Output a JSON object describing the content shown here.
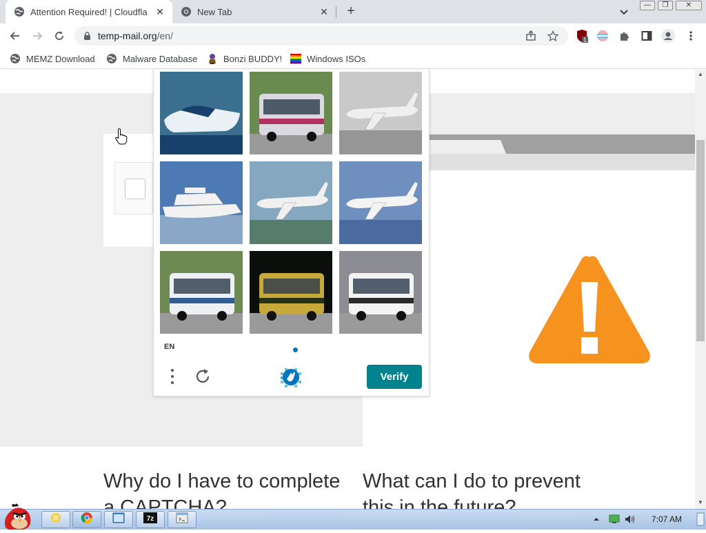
{
  "browser": {
    "tabs": [
      {
        "title": "Attention Required! | Cloudfla",
        "active": true
      },
      {
        "title": "New Tab",
        "active": false
      }
    ],
    "address": {
      "domain": "temp-mail.org",
      "path": "/en/"
    },
    "bookmarks": [
      {
        "label": "MEMZ Download",
        "icon": "globe-icon"
      },
      {
        "label": "Malware Database",
        "icon": "globe-icon"
      },
      {
        "label": "Bonzi BUDDY!",
        "icon": "bonzi-icon"
      },
      {
        "label": "Windows ISOs",
        "icon": "rainbow-flag-icon"
      }
    ],
    "extension_badge": "1"
  },
  "captcha": {
    "images": [
      {
        "subject": "speedboat",
        "palette": [
          "#3a6f8f",
          "#e9f1f7",
          "#17406a"
        ]
      },
      {
        "subject": "bus",
        "palette": [
          "#6a8b4f",
          "#d9d9df",
          "#b2305d"
        ]
      },
      {
        "subject": "airplane",
        "palette": [
          "#c9c9c9",
          "#efefef",
          "#6c6c6c"
        ]
      },
      {
        "subject": "yacht",
        "palette": [
          "#4d79b5",
          "#f2f2f2",
          "#8aa7c8"
        ]
      },
      {
        "subject": "airplane",
        "palette": [
          "#86a7c0",
          "#f0f0f0",
          "#2f5a24"
        ]
      },
      {
        "subject": "airplane",
        "palette": [
          "#6f8fbf",
          "#f4f4f4",
          "#2d4d86"
        ]
      },
      {
        "subject": "bus",
        "palette": [
          "#6d8a52",
          "#eef1f3",
          "#2f5c93"
        ]
      },
      {
        "subject": "bus",
        "palette": [
          "#0c0e0c",
          "#c6a93a",
          "#263216"
        ]
      },
      {
        "subject": "bus",
        "palette": [
          "#8c8c95",
          "#f4f4f4",
          "#2a2a2a"
        ]
      }
    ],
    "language": "EN",
    "verify_label": "Verify",
    "colors": {
      "verify": "#00838f",
      "dot": "#0074bf"
    }
  },
  "page": {
    "left_heading": "Why do I have to complete a CAPTCHA?",
    "right_heading": "What can I do to prevent this in the future?",
    "colors": {
      "warning": "#f6921e"
    }
  },
  "taskbar": {
    "clock": "7:07 AM",
    "items": [
      "explorer-icon",
      "chrome-icon",
      "window-icon",
      "7zip-icon",
      "terminal-icon"
    ],
    "tray_icons": [
      "show-hidden-arrow-icon",
      "network-icon",
      "volume-icon"
    ]
  }
}
